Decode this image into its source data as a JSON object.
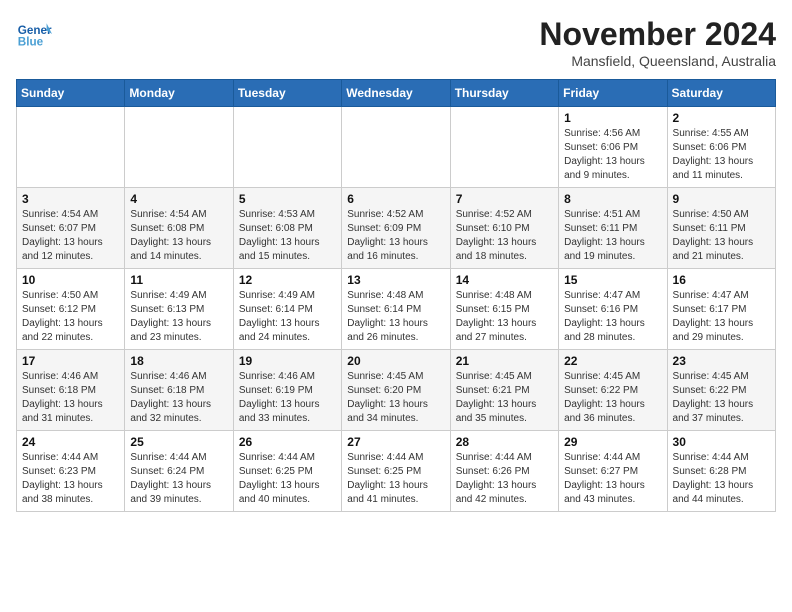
{
  "logo": {
    "text_general": "General",
    "text_blue": "Blue"
  },
  "header": {
    "month": "November 2024",
    "location": "Mansfield, Queensland, Australia"
  },
  "weekdays": [
    "Sunday",
    "Monday",
    "Tuesday",
    "Wednesday",
    "Thursday",
    "Friday",
    "Saturday"
  ],
  "weeks": [
    [
      {
        "day": "",
        "info": ""
      },
      {
        "day": "",
        "info": ""
      },
      {
        "day": "",
        "info": ""
      },
      {
        "day": "",
        "info": ""
      },
      {
        "day": "",
        "info": ""
      },
      {
        "day": "1",
        "info": "Sunrise: 4:56 AM\nSunset: 6:06 PM\nDaylight: 13 hours and 9 minutes."
      },
      {
        "day": "2",
        "info": "Sunrise: 4:55 AM\nSunset: 6:06 PM\nDaylight: 13 hours and 11 minutes."
      }
    ],
    [
      {
        "day": "3",
        "info": "Sunrise: 4:54 AM\nSunset: 6:07 PM\nDaylight: 13 hours and 12 minutes."
      },
      {
        "day": "4",
        "info": "Sunrise: 4:54 AM\nSunset: 6:08 PM\nDaylight: 13 hours and 14 minutes."
      },
      {
        "day": "5",
        "info": "Sunrise: 4:53 AM\nSunset: 6:08 PM\nDaylight: 13 hours and 15 minutes."
      },
      {
        "day": "6",
        "info": "Sunrise: 4:52 AM\nSunset: 6:09 PM\nDaylight: 13 hours and 16 minutes."
      },
      {
        "day": "7",
        "info": "Sunrise: 4:52 AM\nSunset: 6:10 PM\nDaylight: 13 hours and 18 minutes."
      },
      {
        "day": "8",
        "info": "Sunrise: 4:51 AM\nSunset: 6:11 PM\nDaylight: 13 hours and 19 minutes."
      },
      {
        "day": "9",
        "info": "Sunrise: 4:50 AM\nSunset: 6:11 PM\nDaylight: 13 hours and 21 minutes."
      }
    ],
    [
      {
        "day": "10",
        "info": "Sunrise: 4:50 AM\nSunset: 6:12 PM\nDaylight: 13 hours and 22 minutes."
      },
      {
        "day": "11",
        "info": "Sunrise: 4:49 AM\nSunset: 6:13 PM\nDaylight: 13 hours and 23 minutes."
      },
      {
        "day": "12",
        "info": "Sunrise: 4:49 AM\nSunset: 6:14 PM\nDaylight: 13 hours and 24 minutes."
      },
      {
        "day": "13",
        "info": "Sunrise: 4:48 AM\nSunset: 6:14 PM\nDaylight: 13 hours and 26 minutes."
      },
      {
        "day": "14",
        "info": "Sunrise: 4:48 AM\nSunset: 6:15 PM\nDaylight: 13 hours and 27 minutes."
      },
      {
        "day": "15",
        "info": "Sunrise: 4:47 AM\nSunset: 6:16 PM\nDaylight: 13 hours and 28 minutes."
      },
      {
        "day": "16",
        "info": "Sunrise: 4:47 AM\nSunset: 6:17 PM\nDaylight: 13 hours and 29 minutes."
      }
    ],
    [
      {
        "day": "17",
        "info": "Sunrise: 4:46 AM\nSunset: 6:18 PM\nDaylight: 13 hours and 31 minutes."
      },
      {
        "day": "18",
        "info": "Sunrise: 4:46 AM\nSunset: 6:18 PM\nDaylight: 13 hours and 32 minutes."
      },
      {
        "day": "19",
        "info": "Sunrise: 4:46 AM\nSunset: 6:19 PM\nDaylight: 13 hours and 33 minutes."
      },
      {
        "day": "20",
        "info": "Sunrise: 4:45 AM\nSunset: 6:20 PM\nDaylight: 13 hours and 34 minutes."
      },
      {
        "day": "21",
        "info": "Sunrise: 4:45 AM\nSunset: 6:21 PM\nDaylight: 13 hours and 35 minutes."
      },
      {
        "day": "22",
        "info": "Sunrise: 4:45 AM\nSunset: 6:22 PM\nDaylight: 13 hours and 36 minutes."
      },
      {
        "day": "23",
        "info": "Sunrise: 4:45 AM\nSunset: 6:22 PM\nDaylight: 13 hours and 37 minutes."
      }
    ],
    [
      {
        "day": "24",
        "info": "Sunrise: 4:44 AM\nSunset: 6:23 PM\nDaylight: 13 hours and 38 minutes."
      },
      {
        "day": "25",
        "info": "Sunrise: 4:44 AM\nSunset: 6:24 PM\nDaylight: 13 hours and 39 minutes."
      },
      {
        "day": "26",
        "info": "Sunrise: 4:44 AM\nSunset: 6:25 PM\nDaylight: 13 hours and 40 minutes."
      },
      {
        "day": "27",
        "info": "Sunrise: 4:44 AM\nSunset: 6:25 PM\nDaylight: 13 hours and 41 minutes."
      },
      {
        "day": "28",
        "info": "Sunrise: 4:44 AM\nSunset: 6:26 PM\nDaylight: 13 hours and 42 minutes."
      },
      {
        "day": "29",
        "info": "Sunrise: 4:44 AM\nSunset: 6:27 PM\nDaylight: 13 hours and 43 minutes."
      },
      {
        "day": "30",
        "info": "Sunrise: 4:44 AM\nSunset: 6:28 PM\nDaylight: 13 hours and 44 minutes."
      }
    ]
  ]
}
